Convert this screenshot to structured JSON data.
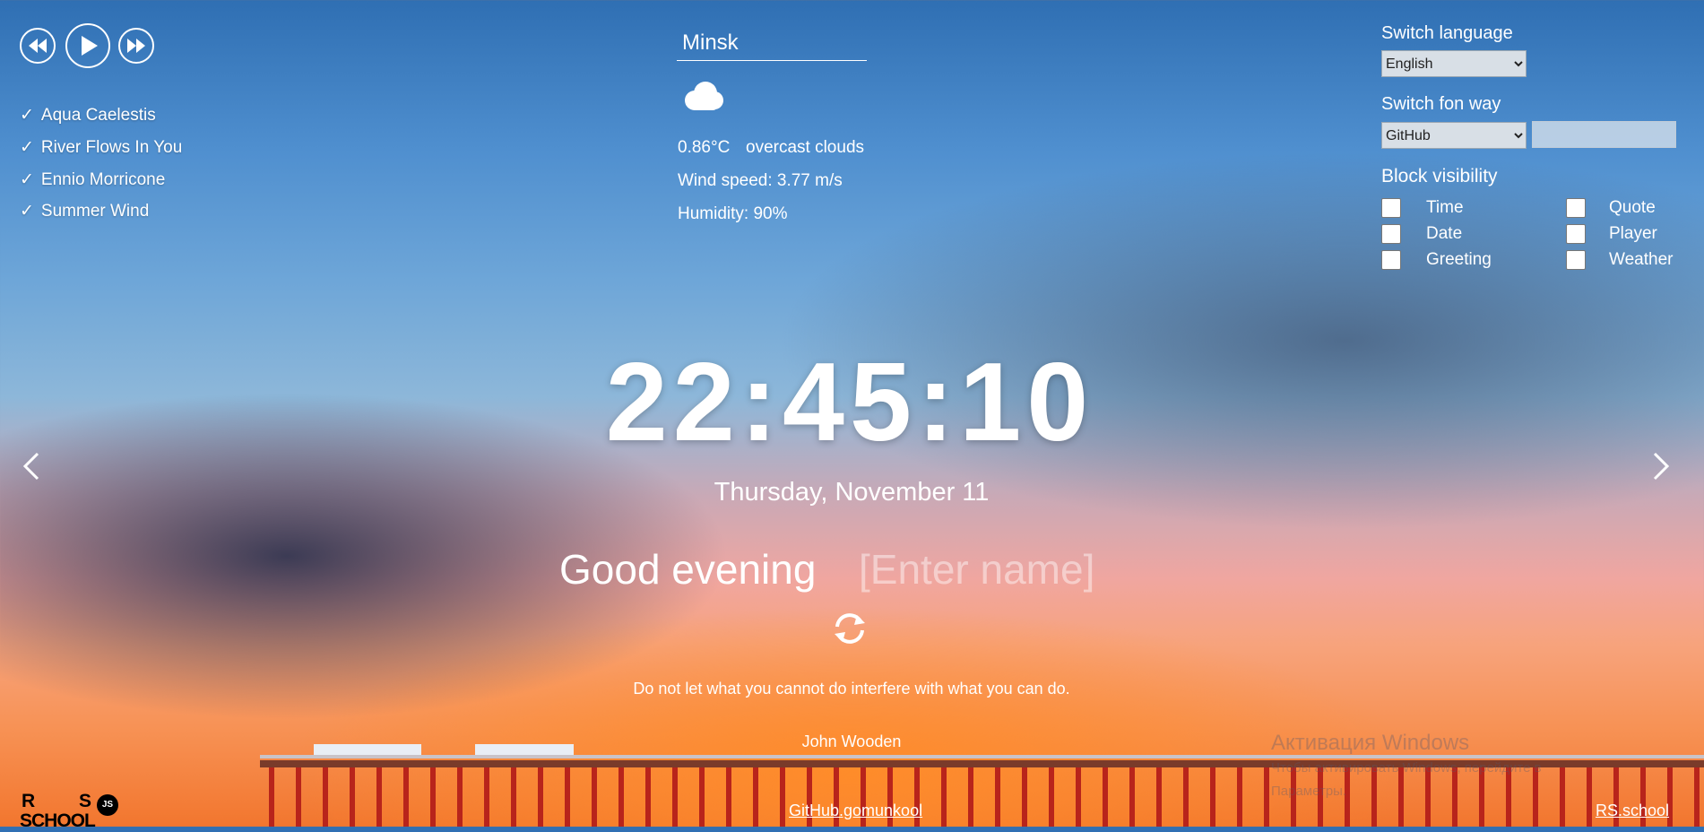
{
  "player": {
    "tracks": [
      {
        "check": "✓",
        "title": "Aqua Caelestis"
      },
      {
        "check": "✓",
        "title": "River Flows In You"
      },
      {
        "check": "✓",
        "title": "Ennio Morricone"
      },
      {
        "check": "✓",
        "title": "Summer Wind"
      }
    ]
  },
  "weather": {
    "city": "Minsk",
    "icon": "cloud-icon",
    "temperature": "0.86°C",
    "description": "overcast clouds",
    "wind": "Wind speed: 3.77 m/s",
    "humidity": "Humidity: 90%"
  },
  "settings": {
    "language_label": "Switch language",
    "language_value": "English",
    "fon_label": "Switch fon way",
    "fon_value": "GitHub",
    "fon_tag_value": "",
    "visibility_label": "Block visibility",
    "blocks": {
      "time": "Time",
      "date": "Date",
      "greeting": "Greeting",
      "quote": "Quote",
      "player": "Player",
      "weather": "Weather"
    }
  },
  "clock": {
    "hours": "22",
    "minutes": "45",
    "seconds": "10",
    "separator": ":"
  },
  "date": "Thursday, November 11",
  "greeting": {
    "text": "Good evening",
    "name_placeholder": "[Enter name]"
  },
  "quote": {
    "text": "Do not let what you cannot do interfere with what you can do.",
    "author": "John Wooden"
  },
  "footer": {
    "logo_r": "R",
    "logo_s": "S",
    "logo_school": "SCHOOL",
    "logo_js": "JS",
    "github_link": "GitHub.gomunkool",
    "rs_link": "RS.school"
  },
  "watermark": {
    "title": "Активация Windows",
    "line1": "Чтобы активировать Windows, перейдите в",
    "line2": "Параметры."
  },
  "colors": {
    "text": "#ffffff",
    "sky_top": "#2f6fb3",
    "sunset": "#f2762e"
  }
}
